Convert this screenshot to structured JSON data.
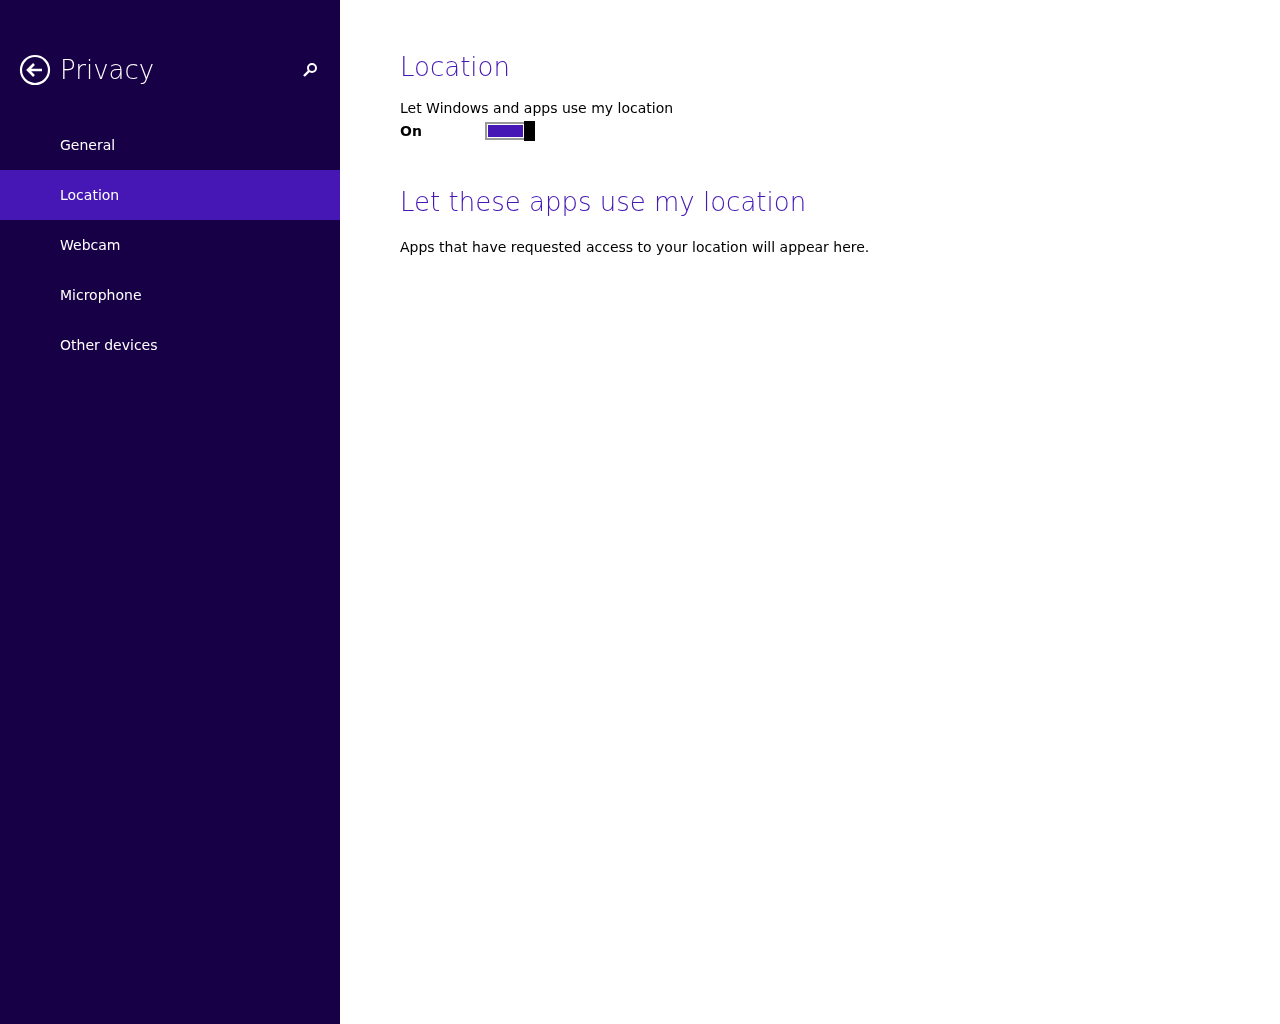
{
  "sidebar": {
    "title": "Privacy",
    "items": [
      {
        "label": "General",
        "selected": false
      },
      {
        "label": "Location",
        "selected": true
      },
      {
        "label": "Webcam",
        "selected": false
      },
      {
        "label": "Microphone",
        "selected": false
      },
      {
        "label": "Other devices",
        "selected": false
      }
    ]
  },
  "content": {
    "heading": "Location",
    "setting_label": "Let Windows and apps use my location",
    "toggle": {
      "state_text": "On",
      "on": true
    },
    "apps_heading": "Let these apps use my location",
    "apps_note": "Apps that have requested access to your location will appear here."
  }
}
